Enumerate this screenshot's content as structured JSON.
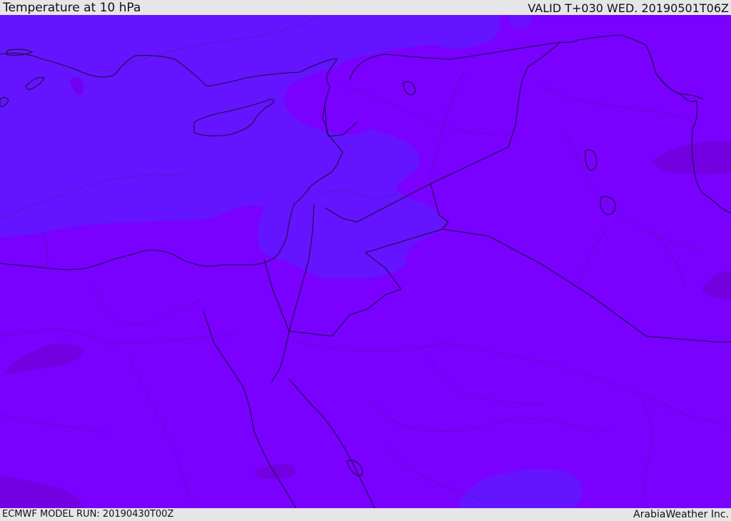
{
  "header": {
    "title": "Temperature at 10 hPa",
    "valid": "VALID T+030 WED. 20190501T06Z"
  },
  "footer": {
    "model_run": "ECMWF MODEL RUN: 20190430T00Z",
    "credit": "ArabiaWeather Inc."
  },
  "colors": {
    "background_fill": "#7a00ff",
    "cooler_band": "#6414ff",
    "warm_patch": "#7300e0",
    "border_line": "#1a1040",
    "internal_border": "#3a2270"
  }
}
